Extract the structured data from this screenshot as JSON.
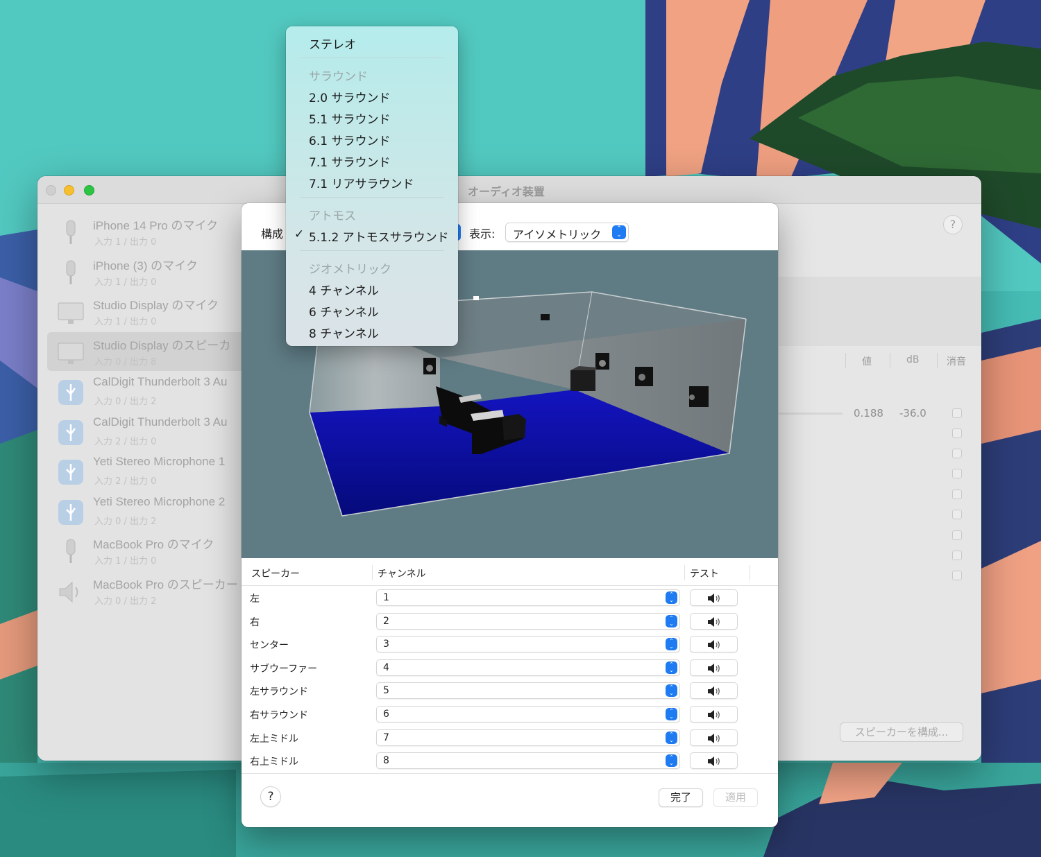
{
  "background_window": {
    "title": "オーディオ装置",
    "help_label": "?",
    "devices": [
      {
        "name": "iPhone 14 Pro のマイク",
        "sub": "入力 1 / 出力 0",
        "icon": "microphone-icon"
      },
      {
        "name": "iPhone (3) のマイク",
        "sub": "入力 1 / 出力 0",
        "icon": "microphone-icon"
      },
      {
        "name": "Studio Display のマイク",
        "sub": "入力 1 / 出力 0",
        "icon": "display-icon"
      },
      {
        "name": "Studio Display のスピーカ",
        "sub": "入力 0 / 出力 8",
        "icon": "display-icon"
      },
      {
        "name": "CalDigit Thunderbolt 3 Au",
        "sub": "入力 0 / 出力 2",
        "icon": "usb-icon"
      },
      {
        "name": "CalDigit Thunderbolt 3 Au",
        "sub": "入力 2 / 出力 0",
        "icon": "usb-icon"
      },
      {
        "name": "Yeti Stereo Microphone 1",
        "sub": "入力 2 / 出力 0",
        "icon": "usb-icon"
      },
      {
        "name": "Yeti Stereo Microphone 2",
        "sub": "入力 0 / 出力 2",
        "icon": "usb-icon"
      },
      {
        "name": "MacBook Pro のマイク",
        "sub": "入力 1 / 出力 0",
        "icon": "microphone-icon"
      },
      {
        "name": "MacBook Pro のスピーカー",
        "sub": "入力 0 / 出力 2",
        "icon": "speaker-icon"
      }
    ],
    "footer": {
      "add": "+",
      "remove": "—",
      "gear": "⚙",
      "chevron": "⌄"
    },
    "columns": {
      "value": "値",
      "db": "dB",
      "mute": "消音"
    },
    "master": {
      "value": "0.188",
      "db": "-36.0"
    },
    "configure_speakers_label": "スピーカーを構成..."
  },
  "sheet": {
    "config_label": "構成",
    "view_label": "表示:",
    "view_value": "アイソメトリック",
    "table_headers": {
      "speaker": "スピーカー",
      "channel": "チャンネル",
      "test": "テスト"
    },
    "rows": [
      {
        "speaker": "左",
        "channel": "1"
      },
      {
        "speaker": "右",
        "channel": "2"
      },
      {
        "speaker": "センター",
        "channel": "3"
      },
      {
        "speaker": "サブウーファー",
        "channel": "4"
      },
      {
        "speaker": "左サラウンド",
        "channel": "5"
      },
      {
        "speaker": "右サラウンド",
        "channel": "6"
      },
      {
        "speaker": "左上ミドル",
        "channel": "7"
      },
      {
        "speaker": "右上ミドル",
        "channel": "8"
      }
    ],
    "help_label": "?",
    "done_label": "完了",
    "apply_label": "適用"
  },
  "menu": {
    "stereo": "ステレオ",
    "surround_header": "サラウンド",
    "surround": [
      "2.0 サラウンド",
      "5.1 サラウンド",
      "6.1 サラウンド",
      "7.1 サラウンド",
      "7.1 リアサラウンド"
    ],
    "atmos_header": "アトモス",
    "atmos_selected": "5.1.2 アトモスサラウンド",
    "check": "✓",
    "geometric_header": "ジオメトリック",
    "geometric": [
      "4 チャンネル",
      "6 チャンネル",
      "8 チャンネル"
    ]
  },
  "colors": {
    "accent": "#1f7bf2",
    "floor": "#0b14a8",
    "viewport_bg": "#5f7b84"
  }
}
